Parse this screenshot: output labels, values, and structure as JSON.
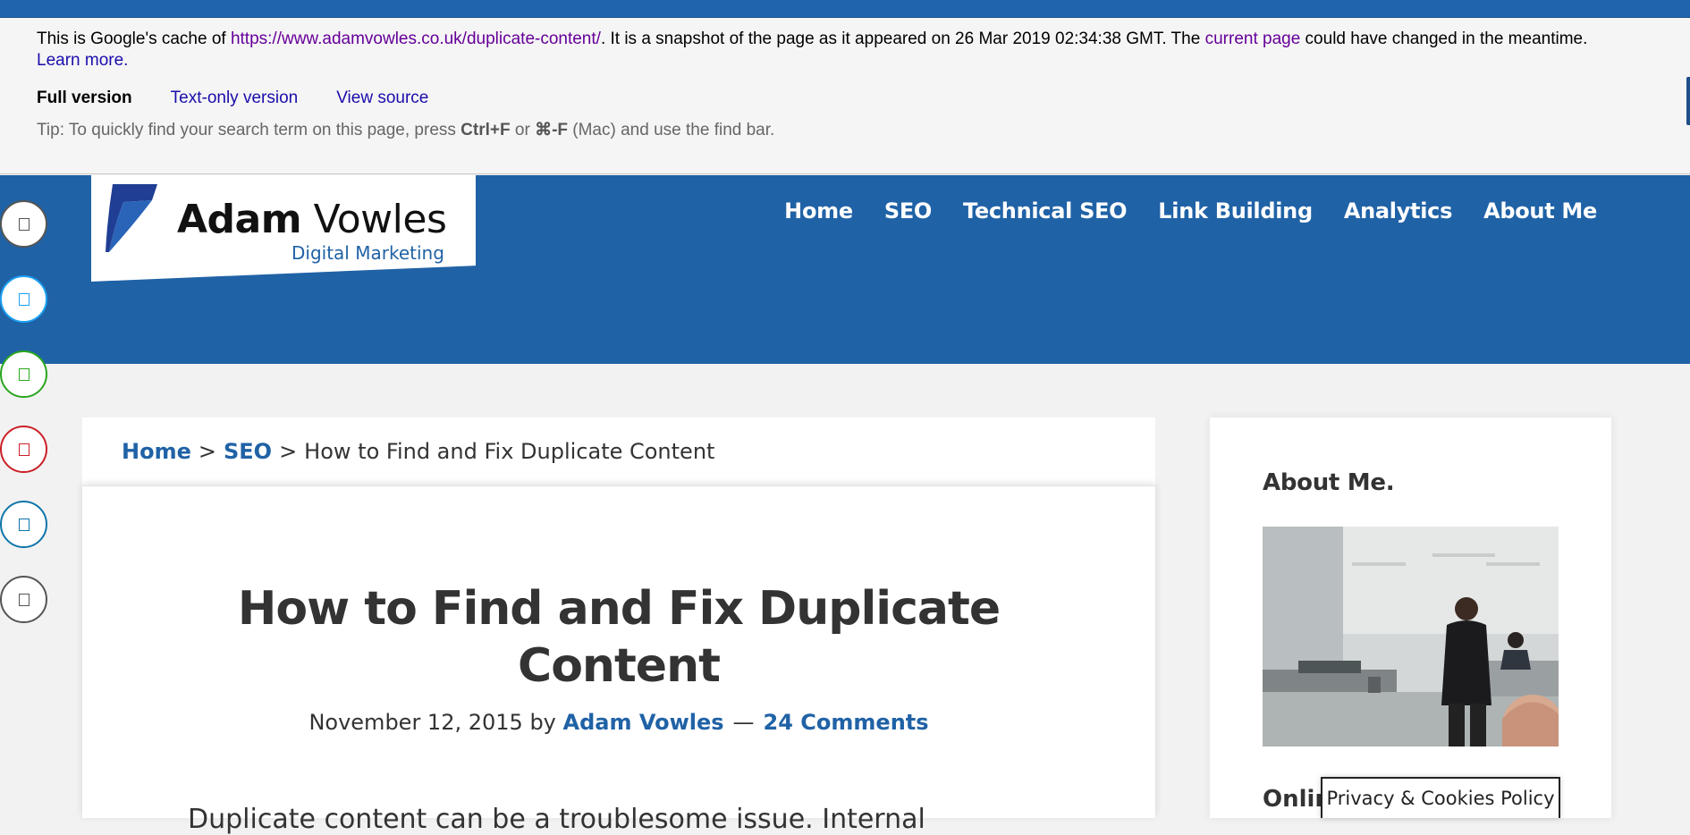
{
  "cache_banner": {
    "text_before_url": "This is Google's cache of ",
    "url": "https://www.adamvowles.co.uk/duplicate-content/",
    "text_after_url": ". It is a snapshot of the page as it appeared on 26 Mar 2019 02:34:38 GMT. The ",
    "current_page_link": "current page",
    "text_after_current": " could have changed in the meantime. ",
    "learn_more_link": "Learn more.",
    "full_version": "Full version",
    "text_only_version": "Text-only version",
    "view_source": "View source",
    "tip_prefix": "Tip: To quickly find your search term on this page, press ",
    "tip_key1": "Ctrl+F",
    "tip_or": " or ",
    "tip_key2": "⌘-F",
    "tip_suffix": " (Mac) and use the find bar."
  },
  "header": {
    "logo_bold": "Adam",
    "logo_regular": " Vowles",
    "logo_tagline": "Digital Marketing",
    "nav": [
      {
        "label": "Home"
      },
      {
        "label": "SEO"
      },
      {
        "label": "Technical SEO"
      },
      {
        "label": "Link Building"
      },
      {
        "label": "Analytics"
      },
      {
        "label": "About Me"
      }
    ]
  },
  "share_bar": {
    "buttons": [
      {
        "icon": "share-icon",
        "color": "#555555"
      },
      {
        "icon": "twitter-icon",
        "color": "#1da1f2"
      },
      {
        "icon": "whatsapp-icon",
        "color": "#2aa61f"
      },
      {
        "icon": "pinterest-icon",
        "color": "#cb2027"
      },
      {
        "icon": "linkedin-icon",
        "color": "#0e76a8"
      },
      {
        "icon": "email-icon",
        "color": "#555555"
      }
    ]
  },
  "breadcrumb": {
    "home": "Home",
    "sep": ">",
    "seo": "SEO",
    "current": "How to Find and Fix Duplicate Content"
  },
  "article": {
    "title_line1": "How to Find and Fix Duplicate",
    "title_line2": "Content",
    "date": "November 12, 2015",
    "by": " by ",
    "author": "Adam Vowles",
    "dash": "—",
    "comments": "24 Comments",
    "lead": "Duplicate content can be a troublesome issue. Internal"
  },
  "sidebar": {
    "about_title": "About Me.",
    "next_heading": "Online"
  },
  "cookie_notice": {
    "label": "Privacy & Cookies Policy"
  },
  "colors": {
    "brand_blue": "#2062a6",
    "visited_link": "#660099",
    "link": "#1a0dab"
  }
}
